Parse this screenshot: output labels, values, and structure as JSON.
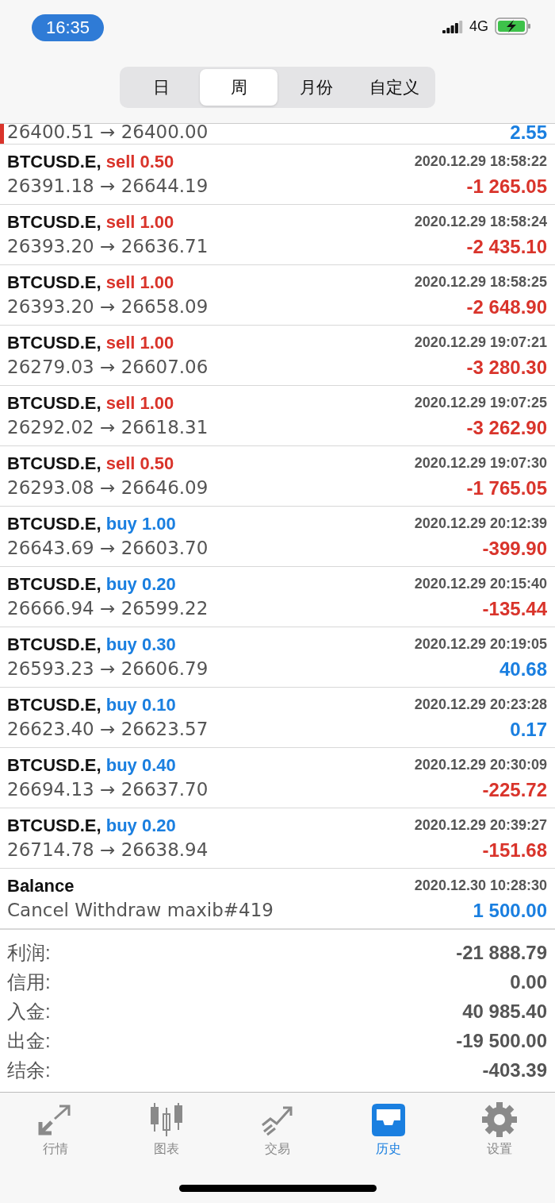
{
  "status_bar": {
    "time": "16:35",
    "network": "4G"
  },
  "period_tabs": [
    {
      "label": "日",
      "selected": false
    },
    {
      "label": "周",
      "selected": true
    },
    {
      "label": "月份",
      "selected": false
    },
    {
      "label": "自定义",
      "selected": false
    }
  ],
  "partial_row": {
    "prices": "26400.51 → 26400.00",
    "profit": "2.55",
    "color": "#1a7fe0"
  },
  "rows": [
    {
      "kind": "trade",
      "symbol": "BTCUSD.E,",
      "side": "sell",
      "lots": "0.50",
      "time": "2020.12.29 18:58:22",
      "prices": "26391.18 → 26644.19",
      "profit": "-1 265.05",
      "color": "#d9342b"
    },
    {
      "kind": "trade",
      "symbol": "BTCUSD.E,",
      "side": "sell",
      "lots": "1.00",
      "time": "2020.12.29 18:58:24",
      "prices": "26393.20 → 26636.71",
      "profit": "-2 435.10",
      "color": "#d9342b"
    },
    {
      "kind": "trade",
      "symbol": "BTCUSD.E,",
      "side": "sell",
      "lots": "1.00",
      "time": "2020.12.29 18:58:25",
      "prices": "26393.20 → 26658.09",
      "profit": "-2 648.90",
      "color": "#d9342b"
    },
    {
      "kind": "trade",
      "symbol": "BTCUSD.E,",
      "side": "sell",
      "lots": "1.00",
      "time": "2020.12.29 19:07:21",
      "prices": "26279.03 → 26607.06",
      "profit": "-3 280.30",
      "color": "#d9342b"
    },
    {
      "kind": "trade",
      "symbol": "BTCUSD.E,",
      "side": "sell",
      "lots": "1.00",
      "time": "2020.12.29 19:07:25",
      "prices": "26292.02 → 26618.31",
      "profit": "-3 262.90",
      "color": "#d9342b"
    },
    {
      "kind": "trade",
      "symbol": "BTCUSD.E,",
      "side": "sell",
      "lots": "0.50",
      "time": "2020.12.29 19:07:30",
      "prices": "26293.08 → 26646.09",
      "profit": "-1 765.05",
      "color": "#d9342b"
    },
    {
      "kind": "trade",
      "symbol": "BTCUSD.E,",
      "side": "buy",
      "lots": "1.00",
      "time": "2020.12.29 20:12:39",
      "prices": "26643.69 → 26603.70",
      "profit": "-399.90",
      "color": "#d9342b"
    },
    {
      "kind": "trade",
      "symbol": "BTCUSD.E,",
      "side": "buy",
      "lots": "0.20",
      "time": "2020.12.29 20:15:40",
      "prices": "26666.94 → 26599.22",
      "profit": "-135.44",
      "color": "#d9342b"
    },
    {
      "kind": "trade",
      "symbol": "BTCUSD.E,",
      "side": "buy",
      "lots": "0.30",
      "time": "2020.12.29 20:19:05",
      "prices": "26593.23 → 26606.79",
      "profit": "40.68",
      "color": "#1a7fe0"
    },
    {
      "kind": "trade",
      "symbol": "BTCUSD.E,",
      "side": "buy",
      "lots": "0.10",
      "time": "2020.12.29 20:23:28",
      "prices": "26623.40 → 26623.57",
      "profit": "0.17",
      "color": "#1a7fe0"
    },
    {
      "kind": "trade",
      "symbol": "BTCUSD.E,",
      "side": "buy",
      "lots": "0.40",
      "time": "2020.12.29 20:30:09",
      "prices": "26694.13 → 26637.70",
      "profit": "-225.72",
      "color": "#d9342b"
    },
    {
      "kind": "trade",
      "symbol": "BTCUSD.E,",
      "side": "buy",
      "lots": "0.20",
      "time": "2020.12.29 20:39:27",
      "prices": "26714.78 → 26638.94",
      "profit": "-151.68",
      "color": "#d9342b"
    },
    {
      "kind": "balance",
      "symbol": "Balance",
      "time": "2020.12.30 10:28:30",
      "prices": "Cancel Withdraw maxib#419",
      "profit": "1 500.00",
      "color": "#1a7fe0"
    }
  ],
  "summary": [
    {
      "label": "利润:",
      "value": "-21 888.79"
    },
    {
      "label": "信用:",
      "value": "0.00"
    },
    {
      "label": "入金:",
      "value": "40 985.40"
    },
    {
      "label": "出金:",
      "value": "-19 500.00"
    },
    {
      "label": "结余:",
      "value": "-403.39"
    }
  ],
  "tab_bar": [
    {
      "label": "行情",
      "selected": false
    },
    {
      "label": "图表",
      "selected": false
    },
    {
      "label": "交易",
      "selected": false
    },
    {
      "label": "历史",
      "selected": true
    },
    {
      "label": "设置",
      "selected": false
    }
  ]
}
